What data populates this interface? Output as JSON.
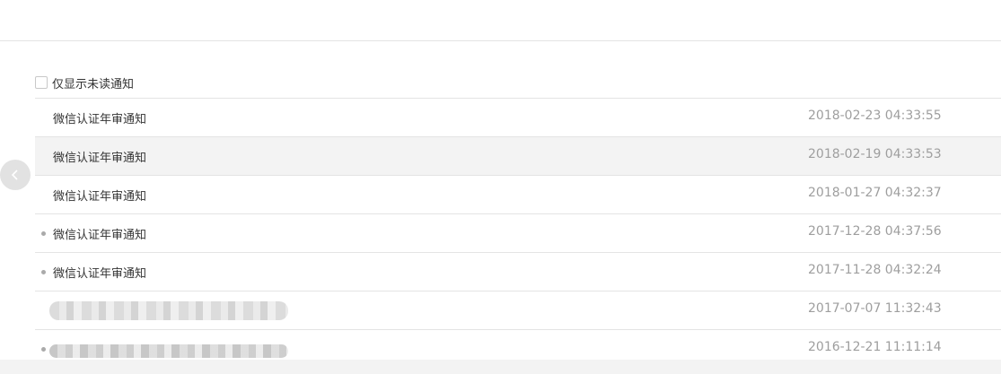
{
  "filter": {
    "label": "仅显示未读通知"
  },
  "notifications": [
    {
      "title": "微信认证年审通知",
      "time": "2018-02-23 04:33:55",
      "unread": false,
      "redacted": false
    },
    {
      "title": "微信认证年审通知",
      "time": "2018-02-19 04:33:53",
      "unread": false,
      "redacted": false
    },
    {
      "title": "微信认证年审通知",
      "time": "2018-01-27 04:32:37",
      "unread": false,
      "redacted": false
    },
    {
      "title": "微信认证年审通知",
      "time": "2017-12-28 04:37:56",
      "unread": true,
      "redacted": false
    },
    {
      "title": "微信认证年审通知",
      "time": "2017-11-28 04:32:24",
      "unread": true,
      "redacted": false
    },
    {
      "title": "",
      "time": "2017-07-07 11:32:43",
      "unread": false,
      "redacted": true
    },
    {
      "title": "",
      "time": "2016-12-21 11:11:14",
      "unread": true,
      "redacted": true
    }
  ],
  "icons": {
    "back": "chevron-left-icon",
    "checkbox": "checkbox-unchecked"
  },
  "colors": {
    "border": "#e4e4e4",
    "hover_row": "#f3f3f3",
    "time_text": "#9e9e9e",
    "unread_dot": "#aaaaaa"
  }
}
